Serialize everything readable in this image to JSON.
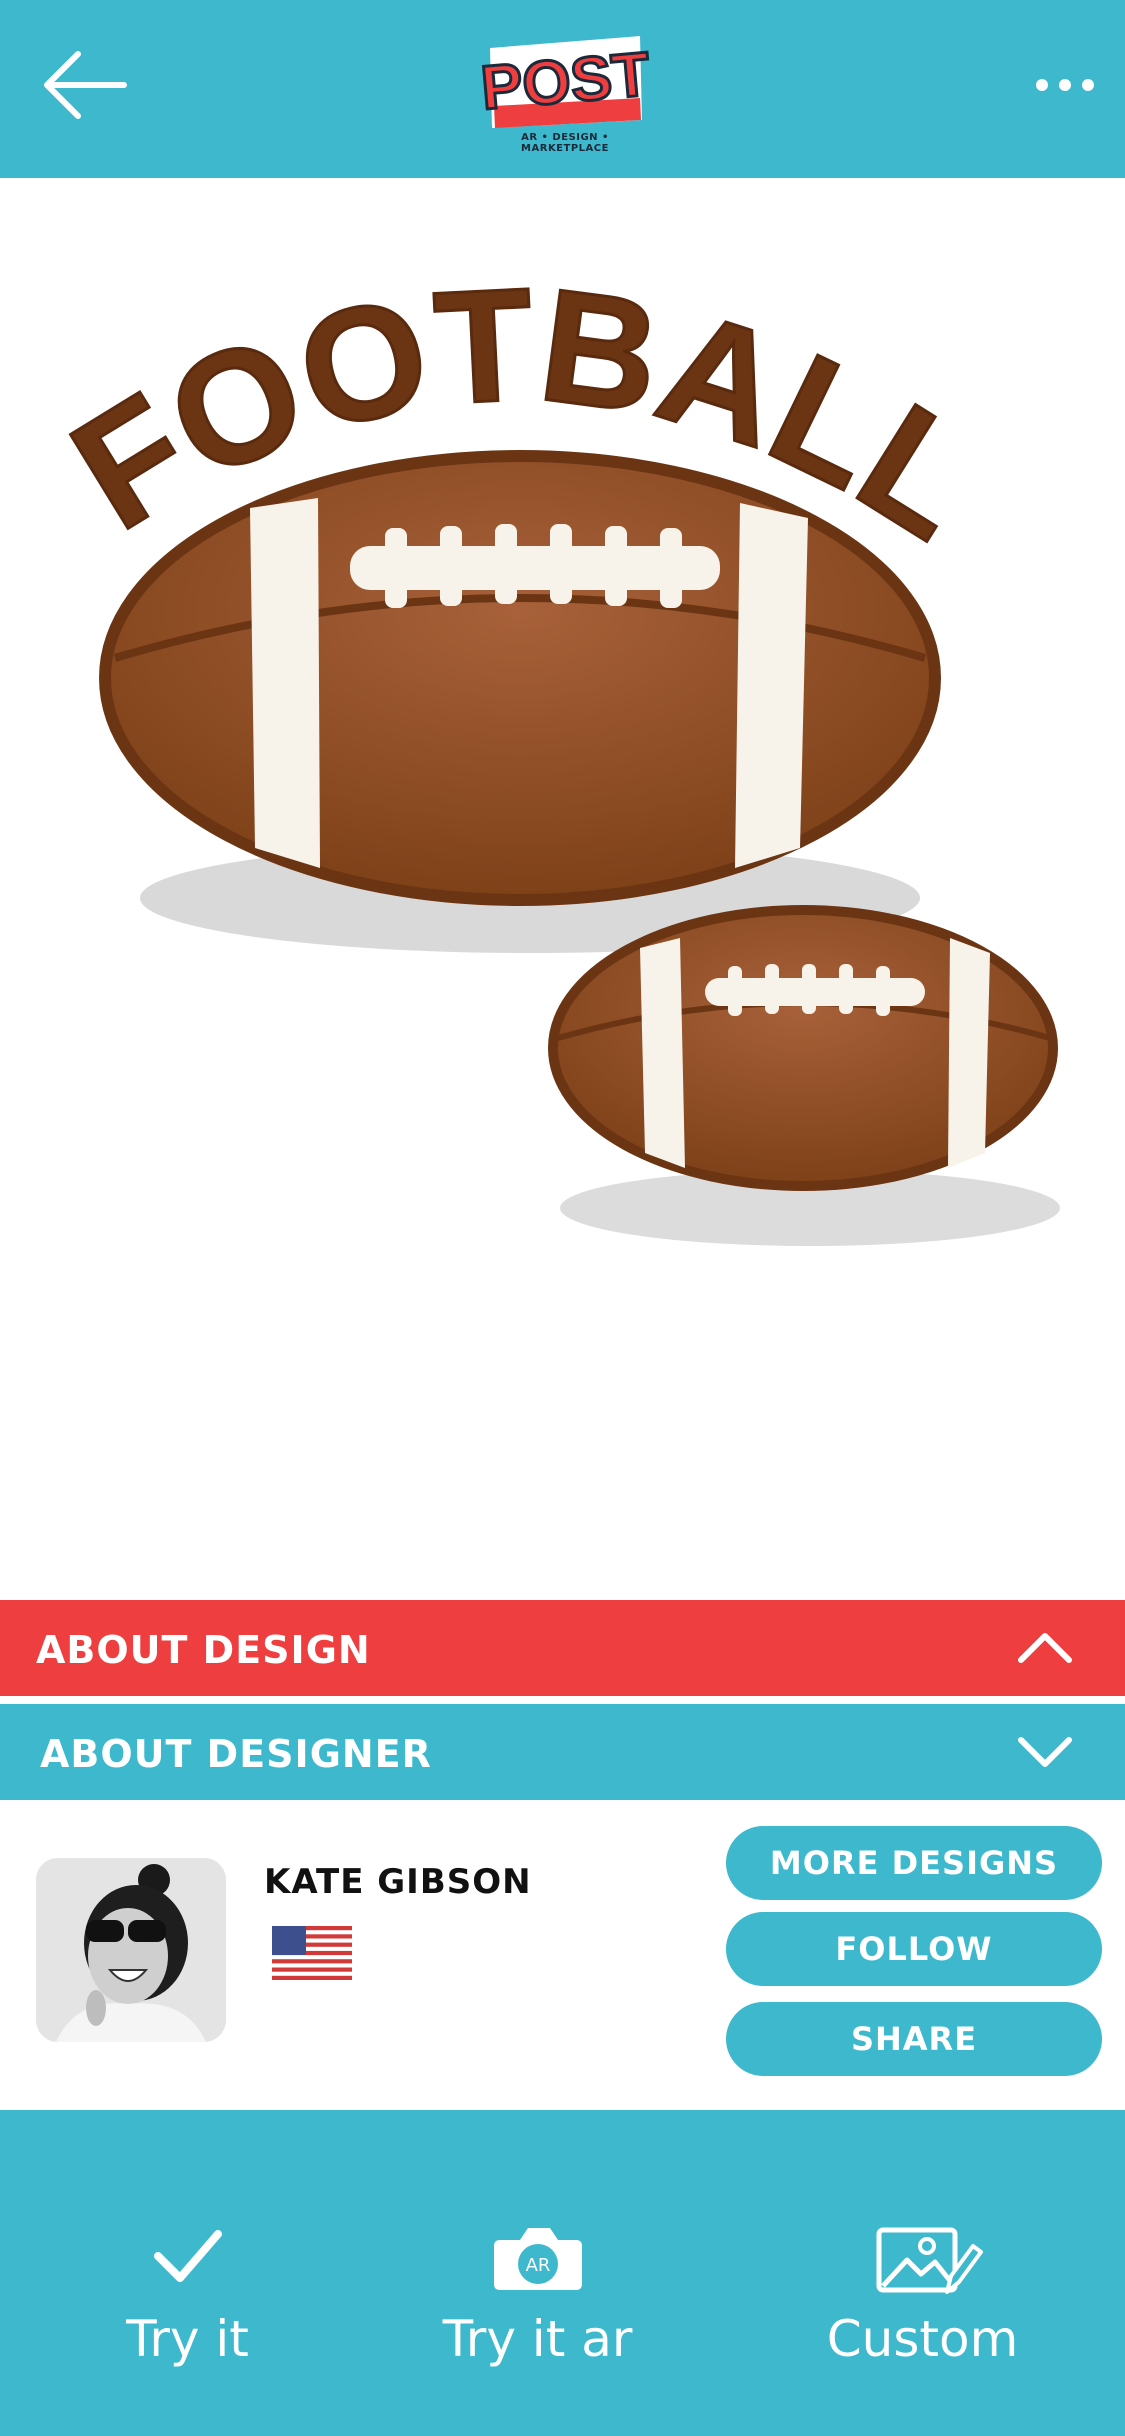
{
  "header": {
    "logo_text": "POST",
    "logo_tagline": "AR • DESIGN • MARKETPLACE",
    "back_icon": "arrow-left-icon",
    "menu_icon": "more-horizontal-icon"
  },
  "artwork": {
    "word": "FOOTBALL"
  },
  "sections": {
    "about_design": "ABOUT DESIGN",
    "about_designer": "ABOUT DESIGNER"
  },
  "designer": {
    "name": "KATE GIBSON",
    "country_flag": "us-flag"
  },
  "actions": {
    "more_designs": "MORE DESIGNS",
    "follow": "FOLLOW",
    "share": "SHARE"
  },
  "bottom_tabs": [
    {
      "label": "Try it",
      "icon": "checkmark-icon"
    },
    {
      "label": "Try it ar",
      "icon": "ar-camera-icon"
    },
    {
      "label": "Custom",
      "icon": "image-edit-icon"
    }
  ],
  "colors": {
    "primary": "#3db8cc",
    "accent": "#ee3e40",
    "ball_brown": "#8b4a1f"
  }
}
